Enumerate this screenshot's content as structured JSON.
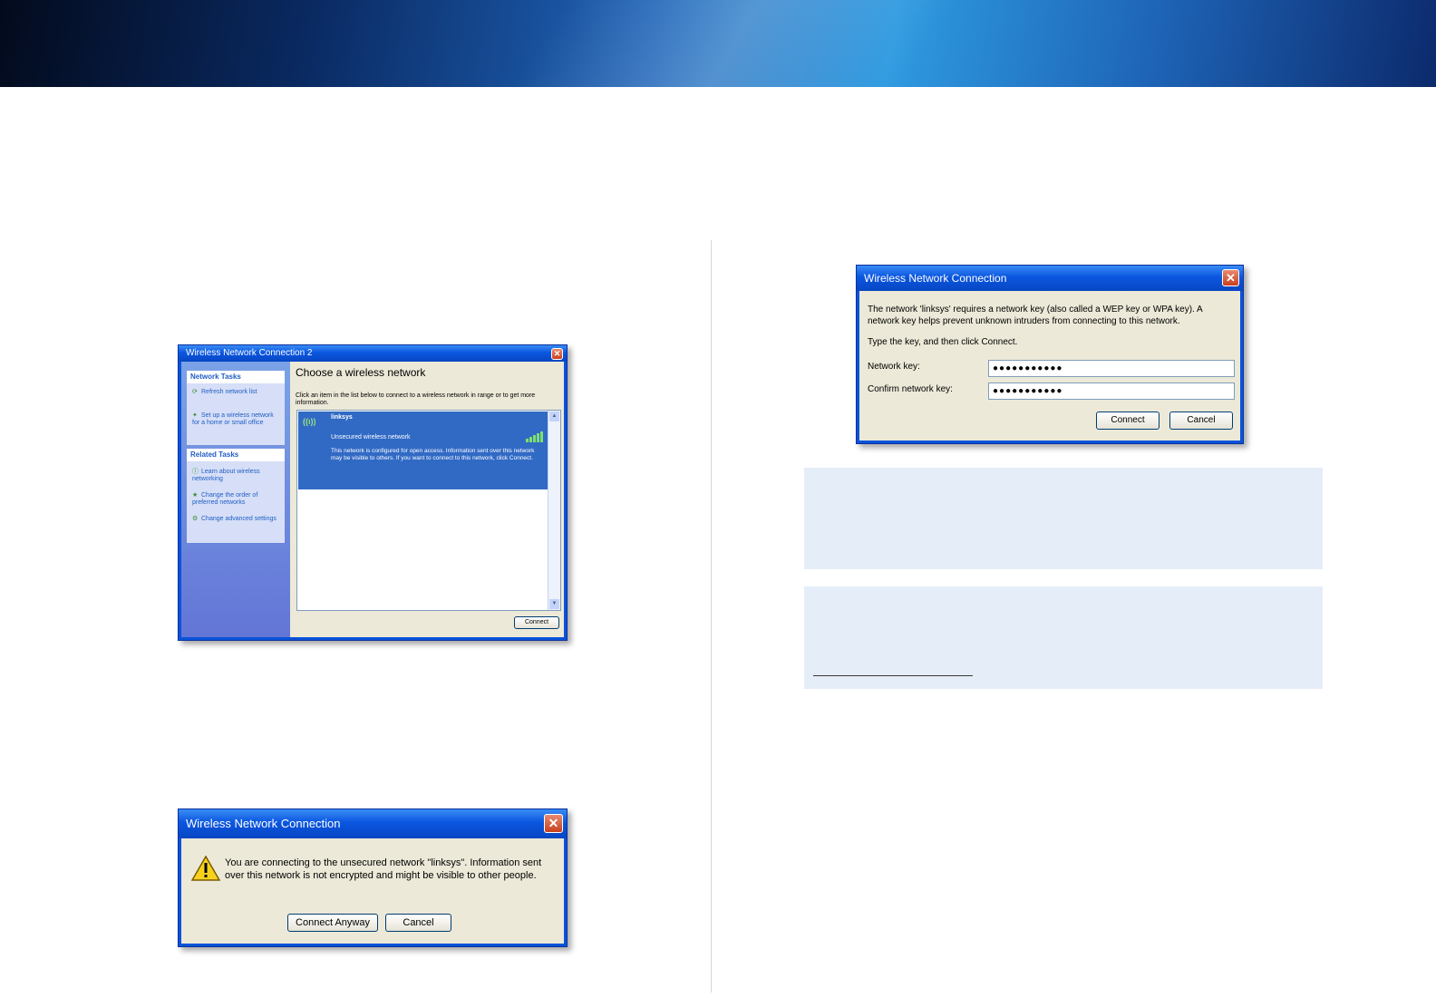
{
  "colors": {
    "banner_dark": "#030a1c",
    "banner_light": "#2e9ae0",
    "xp_blue": "#0a53d9",
    "dialog_bg": "#ece9d8",
    "note_bg": "#e5edf8",
    "selection": "#316ac5"
  },
  "window_choose_network": {
    "title": "Wireless Network Connection 2",
    "network_tasks_heading": "Network Tasks",
    "network_tasks": [
      "Refresh network list",
      "Set up a wireless network for a home or small office"
    ],
    "related_tasks_heading": "Related Tasks",
    "related_tasks": [
      "Learn about wireless networking",
      "Change the order of preferred networks",
      "Change advanced settings"
    ],
    "heading": "Choose a wireless network",
    "instruction": "Click an item in the list below to connect to a wireless network in range or to get more information.",
    "network": {
      "ssid": "linksys",
      "security": "Unsecured wireless network",
      "description": "This network is configured for open access. Information sent over this network may be visible to others. If you want to connect to this network, click Connect."
    },
    "connect_button": "Connect"
  },
  "window_unsecured": {
    "title": "Wireless Network Connection",
    "message": "You are connecting to the unsecured network \"linksys\". Information sent over this network is not encrypted and might be visible to other people.",
    "connect_anyway_button": "Connect Anyway",
    "cancel_button": "Cancel"
  },
  "window_network_key": {
    "title": "Wireless Network Connection",
    "message": "The network 'linksys' requires a network key (also called a WEP key or WPA key). A network key helps prevent unknown intruders from connecting to this network.",
    "type_instruction": "Type the key, and then click Connect.",
    "network_key_label": "Network key:",
    "network_key_value": "●●●●●●●●●●●",
    "confirm_key_label": "Confirm network key:",
    "confirm_key_value": "●●●●●●●●●●●",
    "connect_button": "Connect",
    "cancel_button": "Cancel"
  }
}
